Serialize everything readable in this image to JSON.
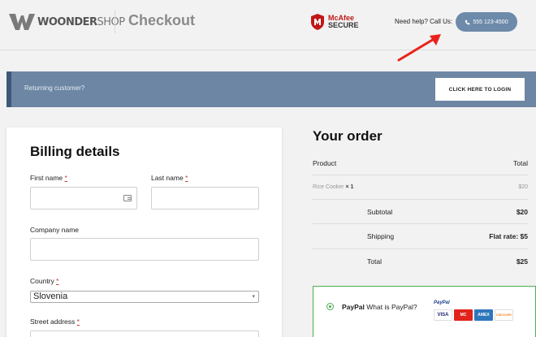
{
  "header": {
    "logo_bold": "WOONDER",
    "logo_light": "SHOP",
    "title": "Checkout",
    "mcafee_line1": "McAfee",
    "mcafee_line2": "SECURE",
    "help_text": "Need help? Call Us:",
    "phone": "555 123-4500",
    "phone_icon": "phone-icon"
  },
  "returning": {
    "text": "Returning customer?",
    "button": "CLICK HERE TO LOGIN"
  },
  "billing": {
    "title": "Billing details",
    "first_name_label": "First name",
    "last_name_label": "Last name",
    "company_label": "Company name",
    "country_label": "Country",
    "country_value": "Slovenia",
    "street_label": "Street address",
    "required_mark": "*"
  },
  "order": {
    "title": "Your order",
    "header_product": "Product",
    "header_total": "Total",
    "item_name": "Rice Cooker",
    "item_qty": "× 1",
    "item_total": "$20",
    "subtotal_label": "Subtotal",
    "subtotal_value": "$20",
    "shipping_label": "Shipping",
    "shipping_value": "Flat rate: $5",
    "total_label": "Total",
    "total_value": "$25"
  },
  "payment": {
    "method": "PayPal",
    "what_is": "What is PayPal?",
    "paypal_mark": "PayPal",
    "cards": [
      "VISA",
      "MC",
      "AMEX",
      "DISCOVER"
    ]
  },
  "colors": {
    "accent_blue": "#6c86a4",
    "call_button": "#6d8aaa",
    "required_red": "#c0392b",
    "paypal_green": "#4caf50",
    "arrow_red": "#e8221a"
  }
}
